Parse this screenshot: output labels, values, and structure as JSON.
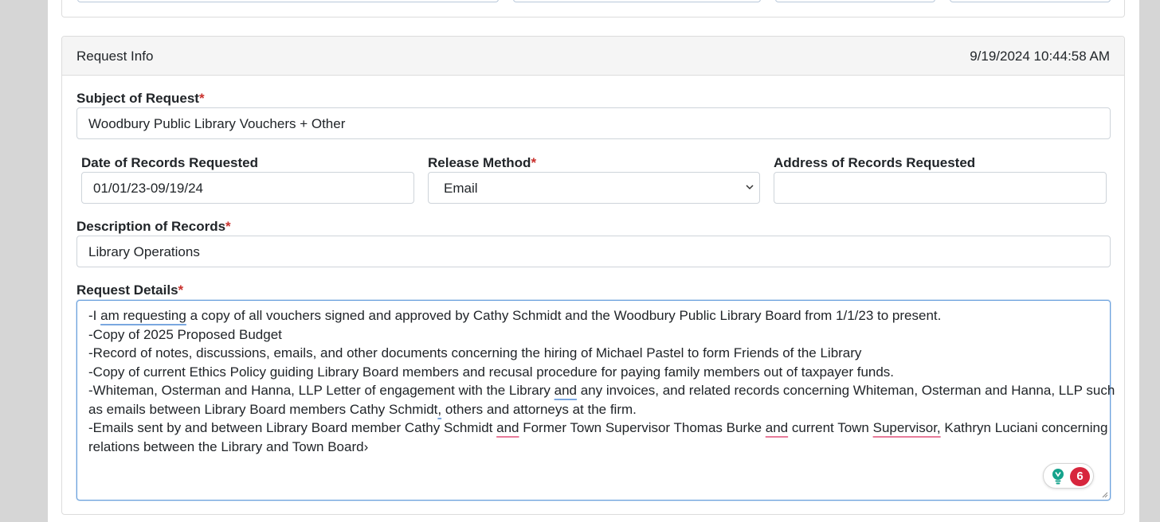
{
  "card": {
    "title": "Request Info",
    "timestamp": "9/19/2024 10:44:58 AM"
  },
  "subject": {
    "label": "Subject of Request",
    "required_mark": "*",
    "value": "Woodbury Public Library Vouchers + Other"
  },
  "date_records": {
    "label": "Date of Records Requested",
    "value": "01/01/23-09/19/24"
  },
  "release_method": {
    "label": "Release Method",
    "required_mark": "*",
    "selected": "Email"
  },
  "address_records": {
    "label": "Address of Records Requested",
    "value": ""
  },
  "description": {
    "label": "Description of Records",
    "required_mark": "*",
    "value": "Library Operations"
  },
  "details": {
    "label": "Request Details",
    "required_mark": "*",
    "lines": {
      "l1_a": "-I ",
      "l1_b": "am requesting",
      "l1_c": " a copy of all vouchers signed and approved by Cathy Schmidt and the Woodbury Public Library Board from 1/1/23 to present.",
      "l2": "-Copy of 2025 Proposed Budget",
      "l3": "-Record of notes, discussions, emails, and other documents concerning the hiring of Michael Pastel to form Friends of the Library",
      "l4": "-Copy of current Ethics Policy guiding Library Board members and recusal procedure for paying family members out of taxpayer funds.",
      "l5_a": "-Whiteman, Osterman and Hanna, LLP Letter of engagement with the Library ",
      "l5_b": "and",
      "l5_c": " any invoices, and related records concerning Whiteman, Osterman and Hanna, LLP such",
      "l6_a": "as emails between Library Board members Cathy Schmidt",
      "l6_b": ",",
      "l6_c": " others and attorneys at the firm.",
      "l7_a": "-Emails sent by and between Library Board member Cathy Schmidt ",
      "l7_b": "and",
      "l7_c": " Former Town Supervisor Thomas Burke ",
      "l7_d": "and",
      "l7_e": " current Town ",
      "l7_f": "Supervisor,",
      "l7_g": " Kathryn Luciani concerning",
      "l8": "relations between the Library and Town Board›"
    }
  },
  "grammar_widget": {
    "count": "6",
    "icon": "lightbulb-icon"
  },
  "colors": {
    "required": "#c9302c",
    "focus_border": "#6aa1dd",
    "badge": "#d7263d",
    "bulb": "#15a38c"
  }
}
